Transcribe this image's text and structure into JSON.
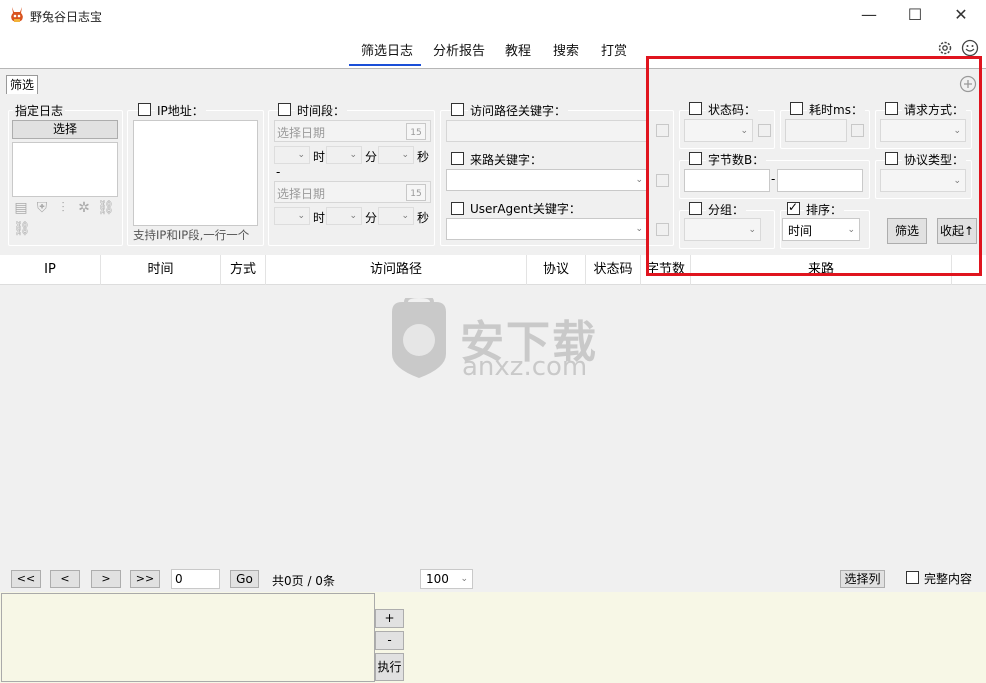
{
  "window": {
    "title": "野兔谷日志宝",
    "minimize": "—",
    "maximize": "☐",
    "close": "✕"
  },
  "nav": {
    "tabs": [
      "筛选日志",
      "分析报告",
      "教程",
      "搜索",
      "打赏"
    ],
    "active_index": 0
  },
  "filter": {
    "tab_label": "筛选",
    "log": {
      "label": "指定日志",
      "select_button": "选择"
    },
    "ip": {
      "label": "IP地址：",
      "hint": "支持IP和IP段,一行一个"
    },
    "time": {
      "label": "时间段：",
      "start_placeholder": "选择日期",
      "end_placeholder": "选择日期",
      "calendar_day": "15",
      "hour_unit": "时",
      "minute_unit": "分",
      "second_unit": "秒",
      "separator": "-"
    },
    "path": {
      "label": "访问路径关键字："
    },
    "referer": {
      "label": "来路关键字："
    },
    "useragent": {
      "label": "UserAgent关键字："
    },
    "status": {
      "label": "状态码："
    },
    "elapsed": {
      "label": "耗时ms："
    },
    "method": {
      "label": "请求方式："
    },
    "bytes": {
      "label": "字节数B：",
      "separator": "-"
    },
    "protocol": {
      "label": "协议类型："
    },
    "group": {
      "label": "分组："
    },
    "sort": {
      "label": "排序：",
      "value": "时间",
      "checked": true
    },
    "filter_button": "筛选",
    "collapse_button": "收起↑"
  },
  "table": {
    "columns": [
      "IP",
      "时间",
      "方式",
      "访问路径",
      "协议",
      "状态码",
      "字节数",
      "来路"
    ]
  },
  "watermark": {
    "text": "安下载",
    "sub": "anxz.com"
  },
  "pager": {
    "first": "<<",
    "prev": "<",
    "next": ">",
    "last": ">>",
    "page_input": "0",
    "go": "Go",
    "summary": "共0页 / 0条",
    "page_size": "100",
    "select_columns": "选择列",
    "full_content": "完整内容"
  },
  "sql": {
    "plus": "+",
    "minus": "-",
    "execute": "执行"
  }
}
